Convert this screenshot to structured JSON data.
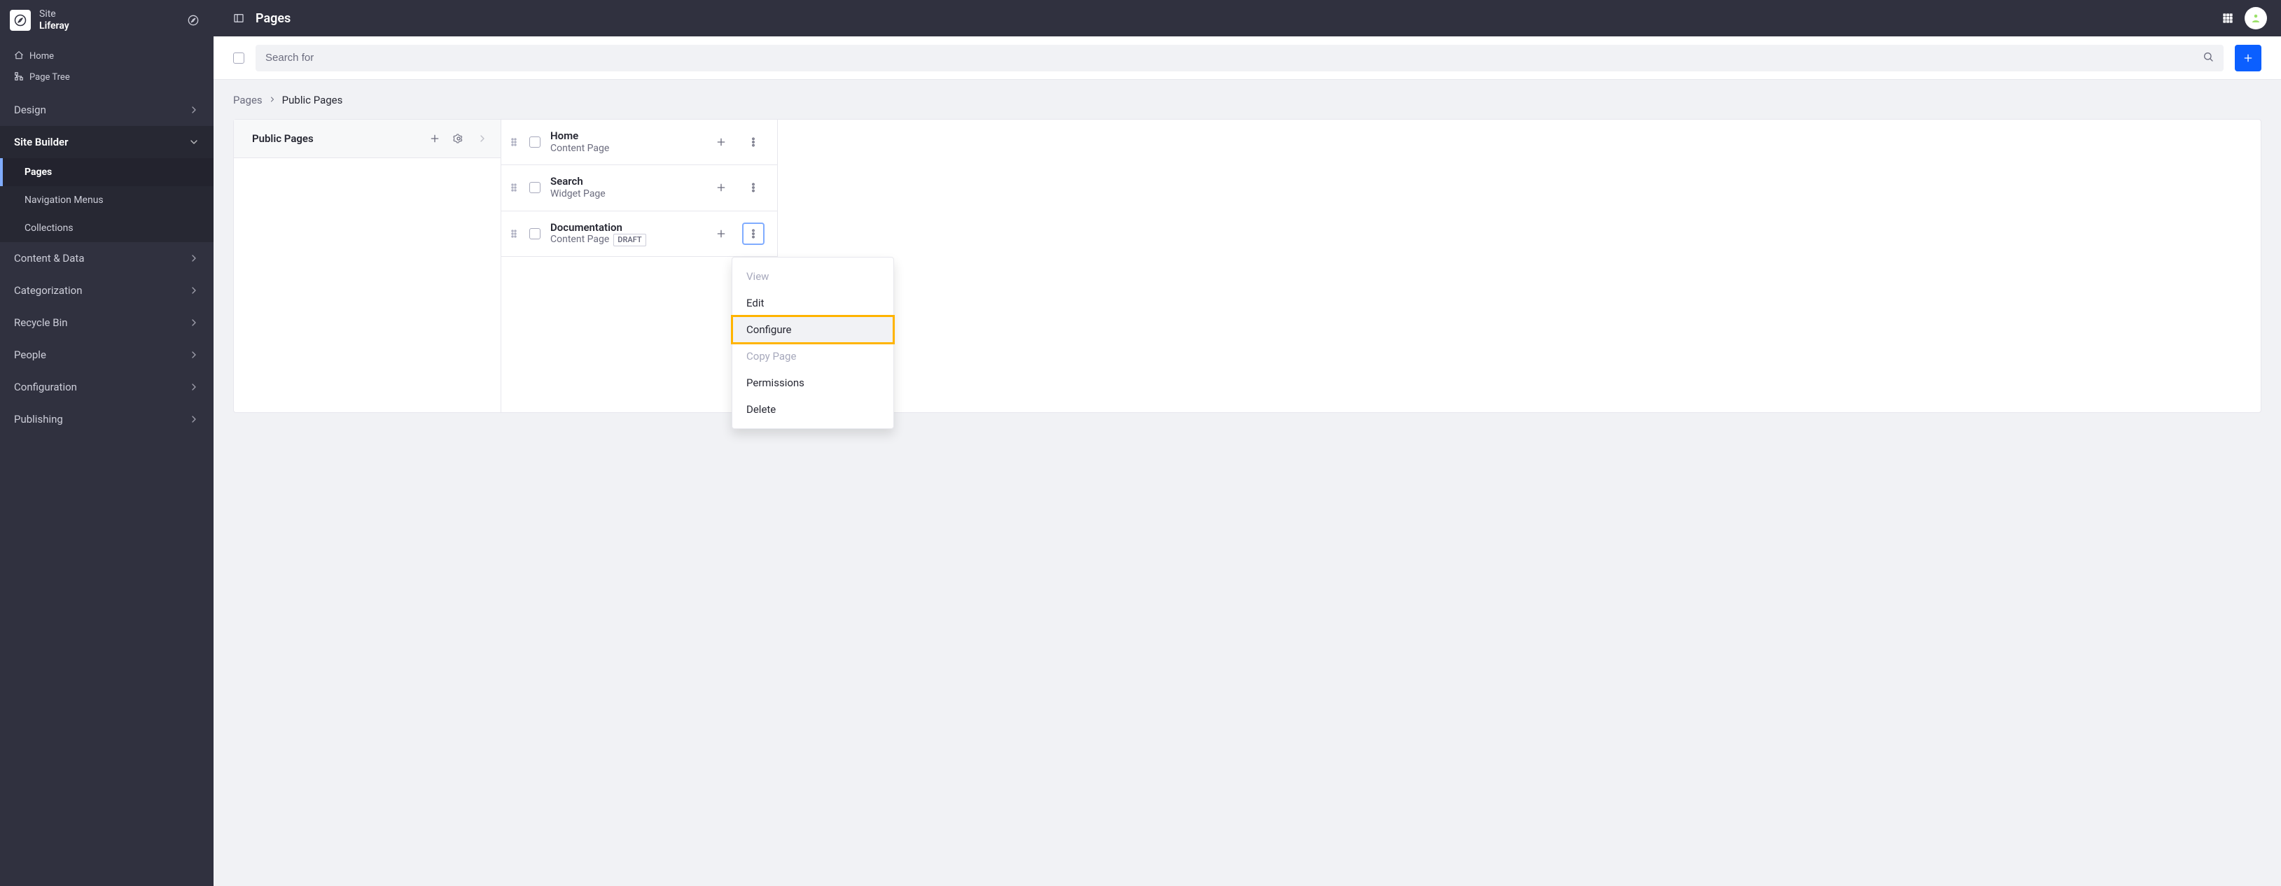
{
  "site": {
    "label": "Site",
    "name": "Liferay"
  },
  "quickLinks": [
    {
      "icon": "home",
      "label": "Home"
    },
    {
      "icon": "tree",
      "label": "Page Tree"
    }
  ],
  "nav": [
    {
      "label": "Design",
      "expanded": false
    },
    {
      "label": "Site Builder",
      "expanded": true,
      "children": [
        {
          "label": "Pages",
          "active": true
        },
        {
          "label": "Navigation Menus"
        },
        {
          "label": "Collections"
        }
      ]
    },
    {
      "label": "Content & Data"
    },
    {
      "label": "Categorization"
    },
    {
      "label": "Recycle Bin"
    },
    {
      "label": "People"
    },
    {
      "label": "Configuration"
    },
    {
      "label": "Publishing"
    }
  ],
  "topbar": {
    "title": "Pages"
  },
  "search": {
    "placeholder": "Search for"
  },
  "breadcrumbs": {
    "first": "Pages",
    "last": "Public Pages"
  },
  "columns": {
    "primary": {
      "title": "Public Pages"
    }
  },
  "rows": [
    {
      "name": "Home",
      "type": "Content Page"
    },
    {
      "name": "Search",
      "type": "Widget Page"
    },
    {
      "name": "Documentation",
      "type": "Content Page",
      "badge": "DRAFT",
      "menuOpen": true
    }
  ],
  "menu": [
    {
      "label": "View",
      "disabled": true
    },
    {
      "label": "Edit"
    },
    {
      "label": "Configure",
      "highlight": true
    },
    {
      "label": "Copy Page",
      "disabled": true
    },
    {
      "label": "Permissions"
    },
    {
      "label": "Delete"
    }
  ]
}
